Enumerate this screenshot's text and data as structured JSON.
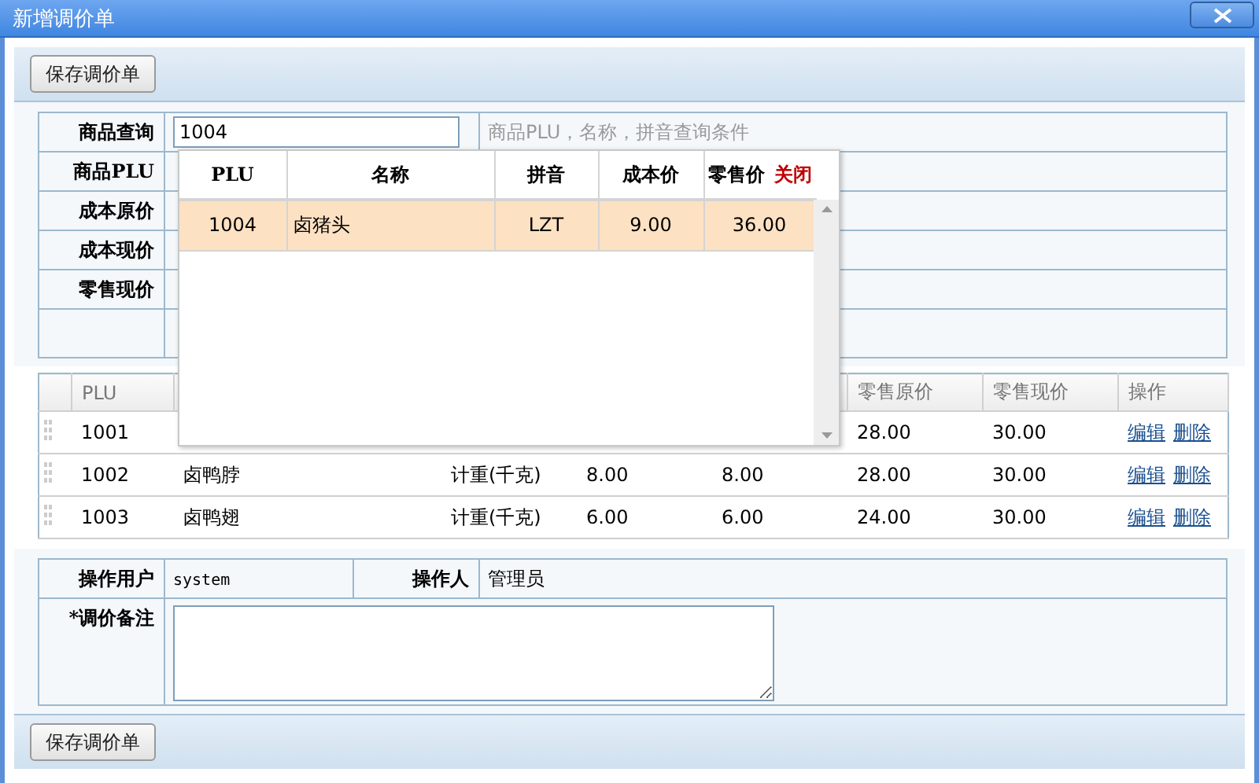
{
  "window": {
    "title": "新增调价单"
  },
  "top_toolbar": {
    "button": "保存调价单"
  },
  "query_form": {
    "search_label": "商品查询",
    "search_value": "1004",
    "search_hint": "商品PLU，名称，拼音查询条件",
    "labels": [
      "商品PLU",
      "成本原价",
      "成本现价",
      "零售现价"
    ]
  },
  "items_table": {
    "columns": [
      "PLU",
      null,
      null,
      null,
      null,
      "零售原价",
      "零售现价",
      "操作"
    ],
    "rows": [
      {
        "cells": [
          "1001",
          null,
          null,
          null,
          null,
          "28.00",
          "30.00"
        ],
        "actions": [
          "编辑",
          "删除"
        ]
      },
      {
        "cells": [
          "1002",
          "卤鸭脖",
          "计重(千克)",
          "8.00",
          "8.00",
          "28.00",
          "30.00"
        ],
        "actions": [
          "编辑",
          "删除"
        ]
      },
      {
        "cells": [
          "1003",
          "卤鸭翅",
          "计重(千克)",
          "6.00",
          "6.00",
          "24.00",
          "30.00"
        ],
        "actions": [
          "编辑",
          "删除"
        ]
      }
    ]
  },
  "lookup_popup": {
    "columns": [
      "PLU",
      "名称",
      "拼音",
      "成本价",
      "零售价"
    ],
    "close_link": "关闭",
    "rows": [
      {
        "cells": [
          "1004",
          "卤猪头",
          "LZT",
          "9.00",
          "36.00"
        ],
        "selected": true
      }
    ]
  },
  "footer_form": {
    "user_label": "操作用户",
    "user": "system",
    "operator_label": "操作人",
    "operator": "管理员",
    "note_label": "*调价备注"
  },
  "bottom_toolbar": {
    "button": "保存调价单"
  }
}
